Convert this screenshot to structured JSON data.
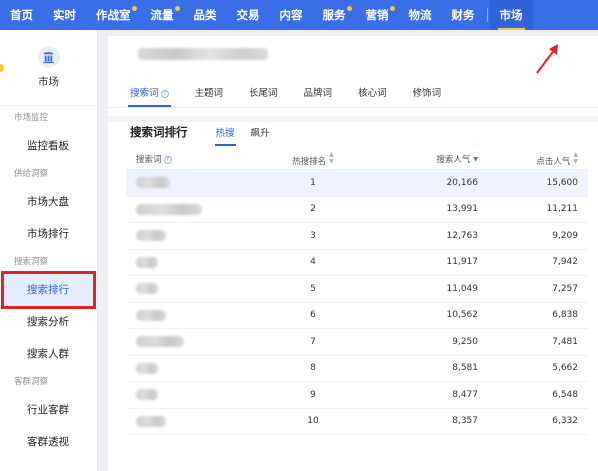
{
  "topnav": {
    "items": [
      {
        "label": "首页",
        "dot": false
      },
      {
        "label": "实时",
        "dot": false
      },
      {
        "label": "作战室",
        "dot": true
      },
      {
        "label": "流量",
        "dot": true
      },
      {
        "label": "品类",
        "dot": false
      },
      {
        "label": "交易",
        "dot": false
      },
      {
        "label": "内容",
        "dot": false
      },
      {
        "label": "服务",
        "dot": true
      },
      {
        "label": "营销",
        "dot": true
      },
      {
        "label": "物流",
        "dot": false
      },
      {
        "label": "财务",
        "dot": false
      },
      {
        "label": "市场",
        "dot": false,
        "active": true
      }
    ]
  },
  "sidebar": {
    "title": "市场",
    "icon": "market-chart-icon",
    "groups": [
      {
        "label": "市场监控",
        "items": [
          {
            "label": "监控看板"
          }
        ]
      },
      {
        "label": "供给洞察",
        "items": [
          {
            "label": "市场大盘"
          },
          {
            "label": "市场排行"
          }
        ]
      },
      {
        "label": "搜索洞察",
        "items": [
          {
            "label": "搜索排行",
            "active": true
          },
          {
            "label": "搜索分析"
          },
          {
            "label": "搜索人群"
          }
        ]
      },
      {
        "label": "客群洞察",
        "items": [
          {
            "label": "行业客群"
          },
          {
            "label": "客群透视"
          }
        ]
      }
    ]
  },
  "main": {
    "tabs": [
      {
        "label": "搜索词",
        "active": true,
        "help": true
      },
      {
        "label": "主题词"
      },
      {
        "label": "长尾词"
      },
      {
        "label": "品牌词"
      },
      {
        "label": "核心词"
      },
      {
        "label": "修饰词"
      }
    ],
    "ranking": {
      "title": "搜索词排行",
      "subtabs": [
        {
          "label": "热搜",
          "active": true
        },
        {
          "label": "飙升"
        }
      ]
    },
    "table": {
      "headers": {
        "word": "搜索词",
        "rank": "热搜排名",
        "search": "搜索人气",
        "click": "点击人气"
      },
      "rows": [
        {
          "rank": "1",
          "search": "20,166",
          "click": "15,600"
        },
        {
          "rank": "2",
          "search": "13,991",
          "click": "11,211"
        },
        {
          "rank": "3",
          "search": "12,763",
          "click": "9,209"
        },
        {
          "rank": "4",
          "search": "11,917",
          "click": "7,942"
        },
        {
          "rank": "5",
          "search": "11,049",
          "click": "7,257"
        },
        {
          "rank": "6",
          "search": "10,562",
          "click": "6,838"
        },
        {
          "rank": "7",
          "search": "9,250",
          "click": "7,481"
        },
        {
          "rank": "8",
          "search": "8,581",
          "click": "5,662"
        },
        {
          "rank": "9",
          "search": "8,477",
          "click": "6,548"
        },
        {
          "rank": "10",
          "search": "8,357",
          "click": "6,332"
        }
      ]
    }
  },
  "colors": {
    "nav": "#3a6ee8",
    "accent": "#2f63d9",
    "highlight_box": "#e02424",
    "dot": "#f6c443"
  }
}
